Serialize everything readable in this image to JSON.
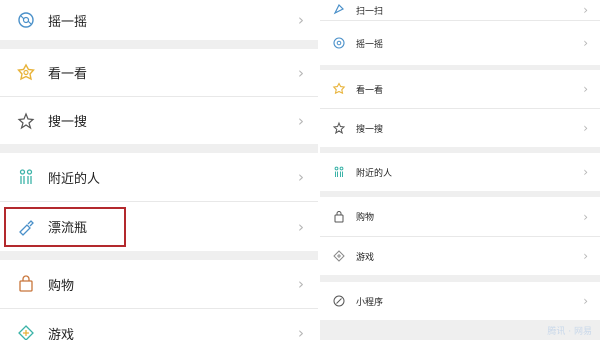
{
  "left_panel": {
    "items": [
      {
        "label": "摇一摇",
        "icon": "shake-icon"
      },
      {
        "label": "看一看",
        "icon": "look-icon"
      },
      {
        "label": "搜一搜",
        "icon": "search-star-icon"
      },
      {
        "label": "附近的人",
        "icon": "people-nearby-icon"
      },
      {
        "label": "漂流瓶",
        "icon": "drift-bottle-icon"
      },
      {
        "label": "购物",
        "icon": "shopping-bag-icon"
      },
      {
        "label": "游戏",
        "icon": "game-icon"
      }
    ]
  },
  "right_panel": {
    "items": [
      {
        "label": "扫一扫",
        "icon": "scan-icon"
      },
      {
        "label": "摇一摇",
        "icon": "shake-icon"
      },
      {
        "label": "看一看",
        "icon": "look-icon"
      },
      {
        "label": "搜一搜",
        "icon": "search-star-icon"
      },
      {
        "label": "附近的人",
        "icon": "people-nearby-icon"
      },
      {
        "label": "购物",
        "icon": "shopping-bag-icon"
      },
      {
        "label": "游戏",
        "icon": "game-icon"
      },
      {
        "label": "小程序",
        "icon": "mini-program-icon"
      }
    ]
  },
  "chevron": "›",
  "highlight": {
    "target": "漂流瓶",
    "color": "#b3292d"
  },
  "watermark": "腾讯 · 网易",
  "colors": {
    "background": "#efefef",
    "row": "#ffffff",
    "accent_blue": "#4a90c9",
    "accent_yellow": "#e8b33a",
    "accent_teal": "#3bb3a8",
    "chevron": "#b6b6b6"
  }
}
